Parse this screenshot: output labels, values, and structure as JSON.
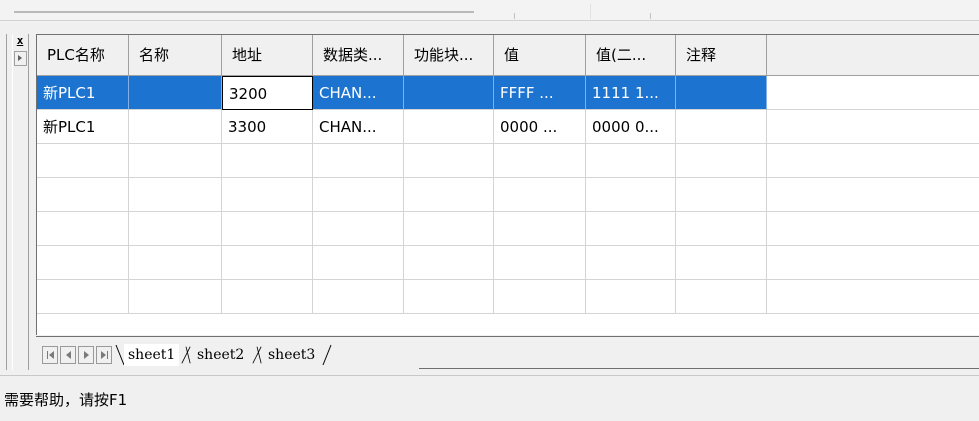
{
  "grid": {
    "columns": [
      "PLC名称",
      "名称",
      "地址",
      "数据类...",
      "功能块...",
      "值",
      "值(二...",
      "注释"
    ],
    "rows": [
      [
        "新PLC1",
        "",
        "3200",
        "CHAN...",
        "",
        "FFFF ...",
        "1111 1...",
        ""
      ],
      [
        "新PLC1",
        "",
        "3300",
        "CHAN...",
        "",
        "0000 ...",
        "0000 0...",
        ""
      ],
      [
        "",
        "",
        "",
        "",
        "",
        "",
        "",
        ""
      ],
      [
        "",
        "",
        "",
        "",
        "",
        "",
        "",
        ""
      ],
      [
        "",
        "",
        "",
        "",
        "",
        "",
        "",
        ""
      ],
      [
        "",
        "",
        "",
        "",
        "",
        "",
        "",
        ""
      ],
      [
        "",
        "",
        "",
        "",
        "",
        "",
        "",
        ""
      ]
    ],
    "selected_row": 0
  },
  "side": {
    "close_glyph": "x"
  },
  "sheets": [
    "sheet1",
    "sheet2",
    "sheet3"
  ],
  "active_sheet": "sheet1",
  "status": {
    "text": "需要帮助，请按F1"
  },
  "colors": {
    "selection": "#1c74d0"
  }
}
